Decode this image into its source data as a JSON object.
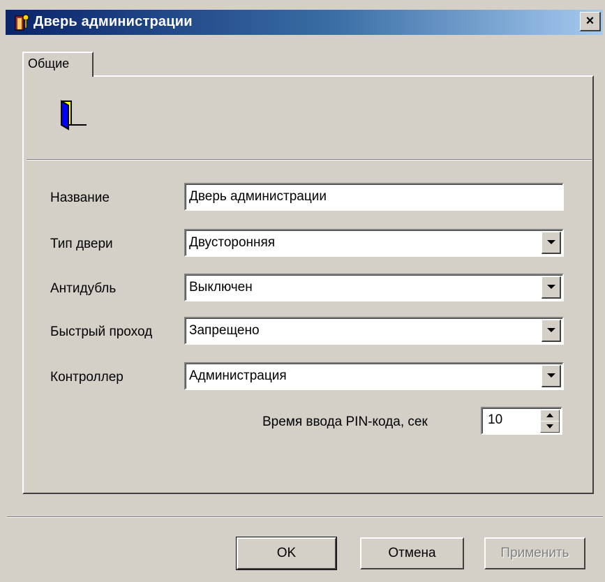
{
  "window": {
    "title": "Дверь администрации",
    "close_label": "×"
  },
  "tabs": [
    {
      "label": "Общие",
      "active": true
    }
  ],
  "form": {
    "name": {
      "label": "Название",
      "value": "Дверь администрации"
    },
    "door_type": {
      "label": "Тип двери",
      "value": "Двусторонняя"
    },
    "antipassback": {
      "label": "Антидубль",
      "value": "Выключен"
    },
    "fast_pass": {
      "label": "Быстрый проход",
      "value": "Запрещено"
    },
    "controller": {
      "label": "Контроллер",
      "value": "Администрация"
    },
    "pin_time": {
      "label": "Время ввода PIN-кода, сек",
      "value": "10"
    }
  },
  "buttons": {
    "ok": "OK",
    "cancel": "Отмена",
    "apply": "Применить"
  },
  "icons": {
    "title": "door-keyholder-icon",
    "tab_header": "door-icon"
  },
  "colors": {
    "titlebar_start": "#0a246a",
    "titlebar_end": "#a6caf0",
    "dialog_bg": "#d4d0c8",
    "door_yellow": "#ffff00",
    "door_blue": "#0000ff"
  }
}
